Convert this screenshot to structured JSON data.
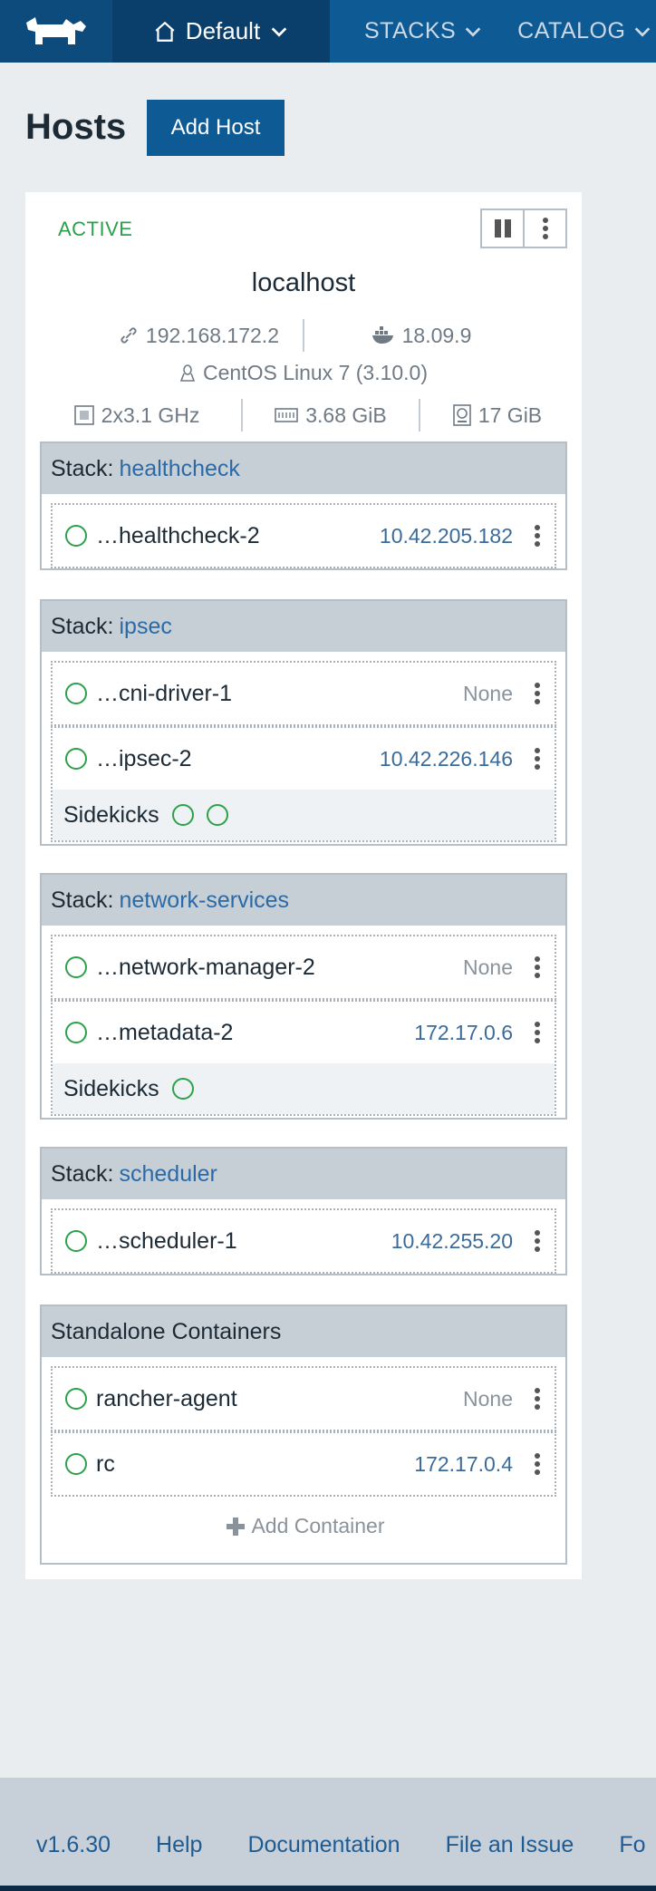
{
  "nav": {
    "environment": "Default",
    "links": [
      "STACKS",
      "CATALOG"
    ]
  },
  "page": {
    "title": "Hosts",
    "add_host_label": "Add Host"
  },
  "host": {
    "state": "ACTIVE",
    "name": "localhost",
    "ip": "192.168.172.2",
    "docker_version": "18.09.9",
    "os": "CentOS Linux 7 (3.10.0)",
    "cpu": "2x3.1 GHz",
    "memory": "3.68 GiB",
    "storage": "17 GiB"
  },
  "stacks": [
    {
      "prefix": "Stack:",
      "name": "healthcheck",
      "containers": [
        {
          "name": "…healthcheck-2",
          "ip": "10.42.205.182"
        }
      ]
    },
    {
      "prefix": "Stack:",
      "name": "ipsec",
      "containers": [
        {
          "name": "…cni-driver-1",
          "ip": "None"
        },
        {
          "name": "…ipsec-2",
          "ip": "10.42.226.146",
          "sidekicks_label": "Sidekicks"
        }
      ]
    },
    {
      "prefix": "Stack:",
      "name": "network-services",
      "containers": [
        {
          "name": "…network-manager-2",
          "ip": "None"
        },
        {
          "name": "…metadata-2",
          "ip": "172.17.0.6",
          "sidekicks_label": "Sidekicks"
        }
      ]
    },
    {
      "prefix": "Stack:",
      "name": "scheduler",
      "containers": [
        {
          "name": "…scheduler-1",
          "ip": "10.42.255.20"
        }
      ]
    }
  ],
  "standalone": {
    "title": "Standalone Containers",
    "containers": [
      {
        "name": "rancher-agent",
        "ip": "None"
      },
      {
        "name": "rc",
        "ip": "172.17.0.4"
      }
    ],
    "add_container_label": "Add Container"
  },
  "footer": {
    "links": [
      "v1.6.30",
      "Help",
      "Documentation",
      "File an Issue",
      "Fo"
    ]
  },
  "colors": {
    "brand": "#0e5a94",
    "active_green": "#2aa14a",
    "link_blue": "#2b6aa6"
  }
}
